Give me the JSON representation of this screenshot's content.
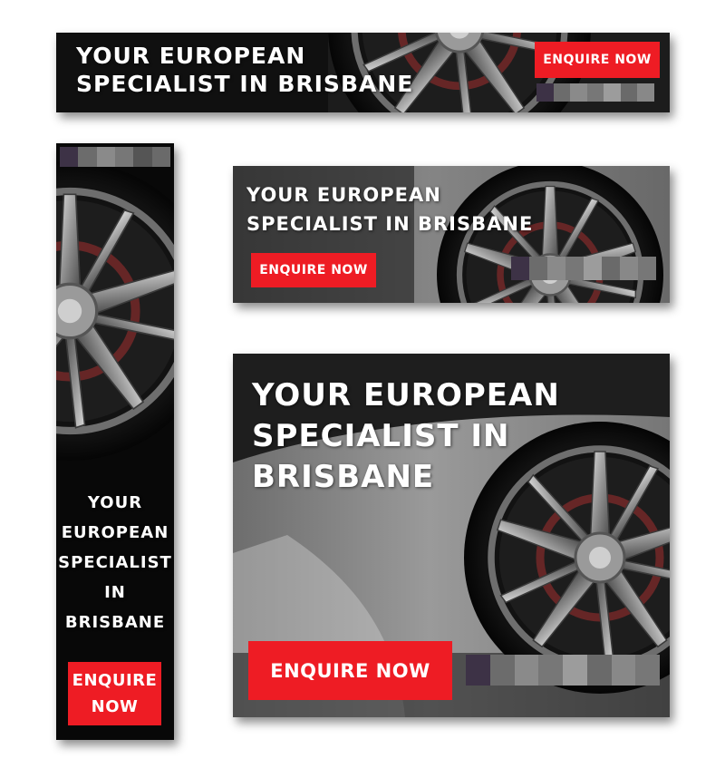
{
  "banners": [
    {
      "headline": [
        "YOUR EUROPEAN",
        "SPECIALIST IN BRISBANE"
      ],
      "cta": "ENQUIRE NOW"
    },
    {
      "headline": [
        "YOUR",
        "EUROPEAN",
        "SPECIALIST",
        "IN",
        "BRISBANE"
      ],
      "cta": "ENQUIRE NOW"
    },
    {
      "headline": [
        "YOUR EUROPEAN",
        "SPECIALIST IN BRISBANE"
      ],
      "cta": "ENQUIRE NOW"
    },
    {
      "headline": [
        "YOUR EUROPEAN",
        "SPECIALIST IN",
        "BRISBANE"
      ],
      "cta": "ENQUIRE NOW"
    }
  ],
  "colors": {
    "accent": "#ee1c24",
    "text": "#ffffff",
    "background": "#0c0c0c"
  },
  "icons": {
    "wheel": "alloy-wheel-icon",
    "logo": "blurred-logo"
  }
}
